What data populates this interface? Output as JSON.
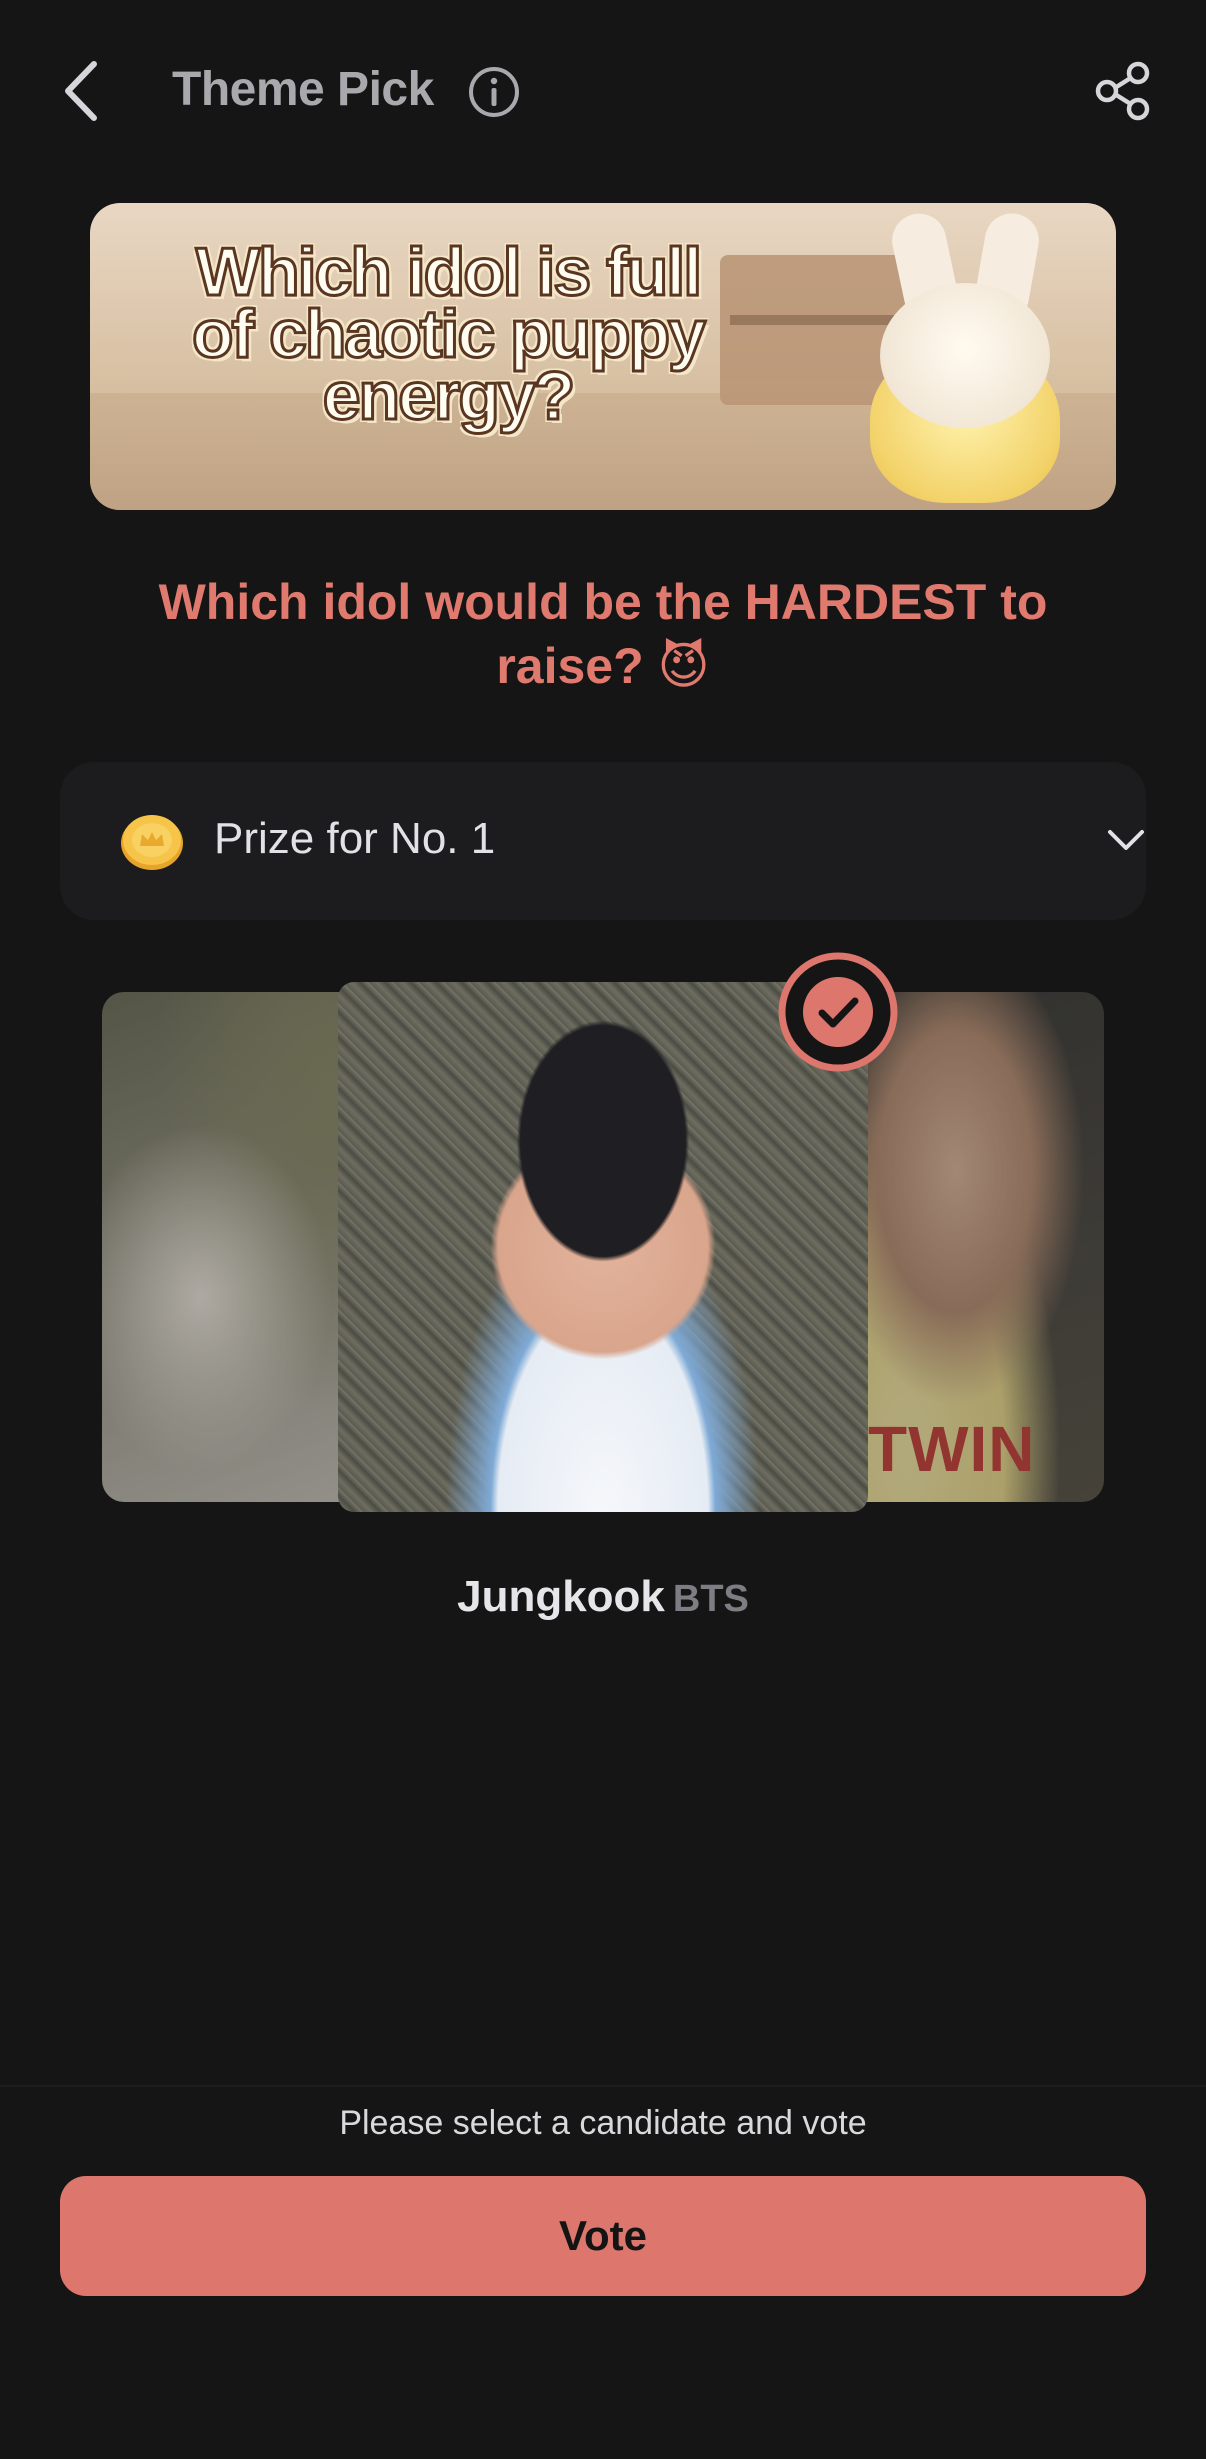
{
  "header": {
    "title": "Theme Pick",
    "back_icon": "chevron-left-icon",
    "info_icon": "info-icon",
    "share_icon": "share-icon"
  },
  "banner": {
    "title": "Which idol is full of chaotic puppy energy?"
  },
  "question": {
    "text": "Which idol would be the HARDEST to raise? 😈"
  },
  "prize": {
    "label": "Prize for No. 1",
    "coin_icon": "coin-icon",
    "expand_icon": "chevron-down-icon"
  },
  "carousel": {
    "selected_badge_icon": "check-circle-icon",
    "candidate": {
      "name": "Jungkook",
      "group": "BTS"
    },
    "side_card_text": "TWIN"
  },
  "footer": {
    "hint": "Please select a candidate and vote",
    "vote_label": "Vote"
  },
  "colors": {
    "background": "#151516",
    "accent": "#dd766c",
    "question_text": "#e07a6f",
    "card_bg": "#1c1c1e"
  }
}
